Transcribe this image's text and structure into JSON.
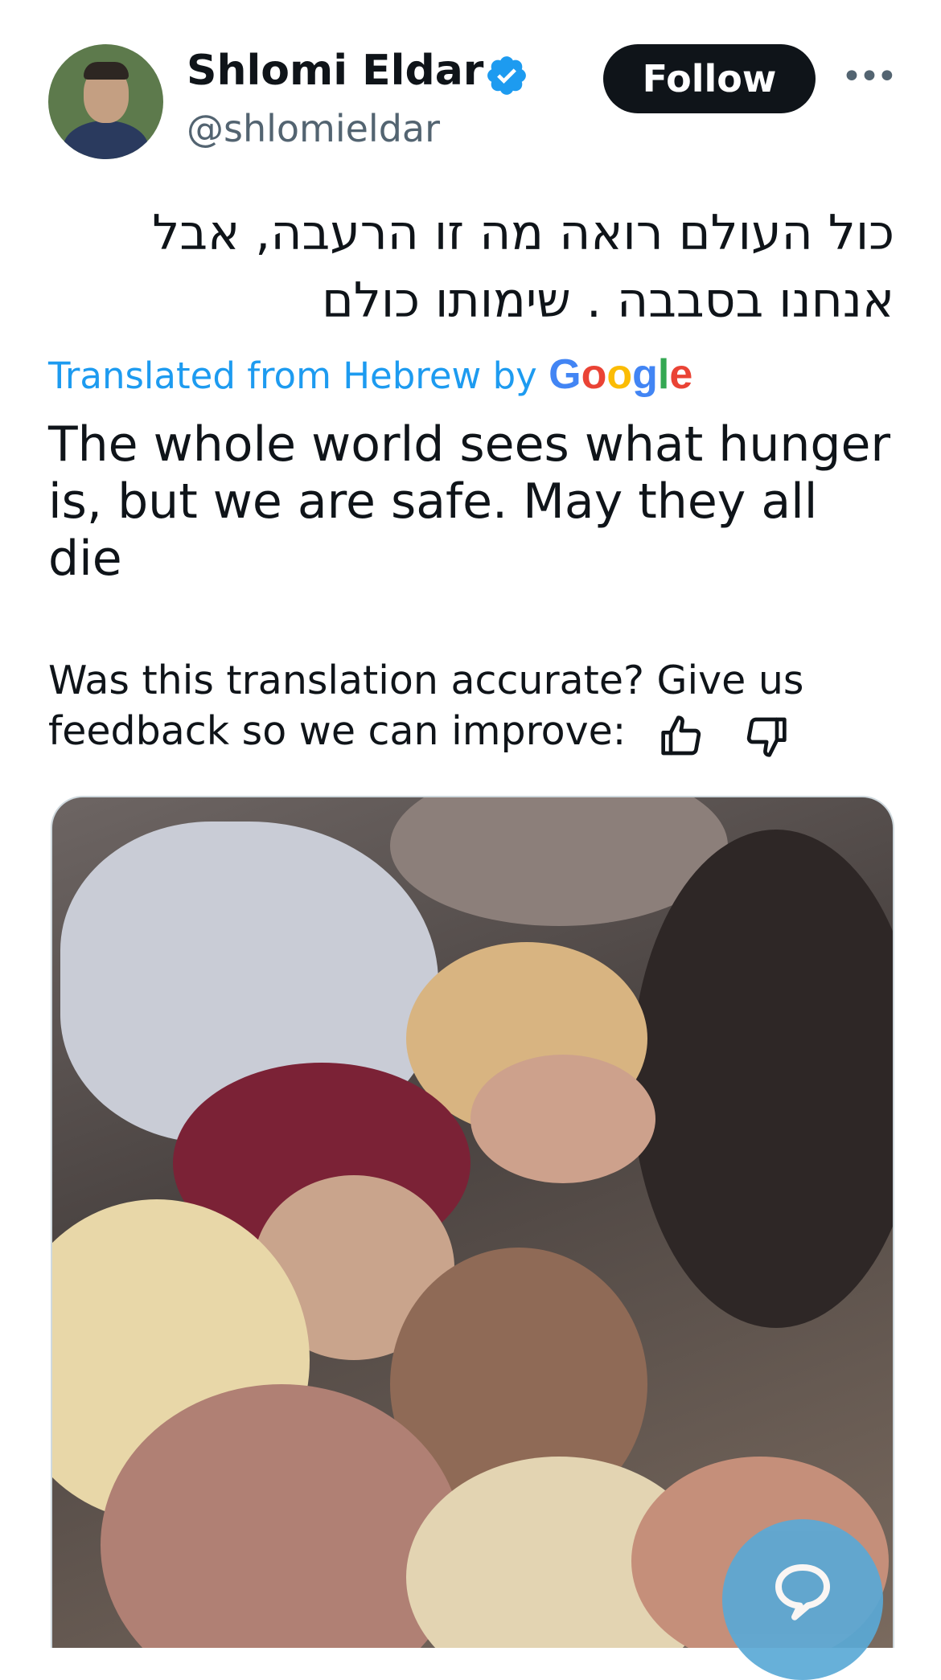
{
  "tweet": {
    "author": {
      "display_name": "Shlomi Eldar",
      "handle": "@shlomieldar",
      "verified": true,
      "avatar_icon": "profile-photo"
    },
    "follow_label": "Follow",
    "more_label": "•••",
    "original_text": "כול העולם רואה מה זו הרעבה, אבל אנחנו בסבבה . שימותו כולם",
    "translation": {
      "label": "Translated from Hebrew by",
      "provider": "Google",
      "text": "The whole world sees what hunger is, but we are safe. May they all die"
    },
    "feedback": {
      "prompt": "Was this translation accurate? Give us feedback so we can improve:",
      "thumbs_up_icon": "thumbs-up-icon",
      "thumbs_down_icon": "thumbs-down-icon"
    },
    "media": {
      "type": "photo",
      "chat_icon": "chat-bubble-icon"
    }
  },
  "colors": {
    "text": "#0f1419",
    "secondary": "#536471",
    "link": "#1d9bf0",
    "verified": "#1d9bf0",
    "follow_bg": "#0f1419"
  }
}
